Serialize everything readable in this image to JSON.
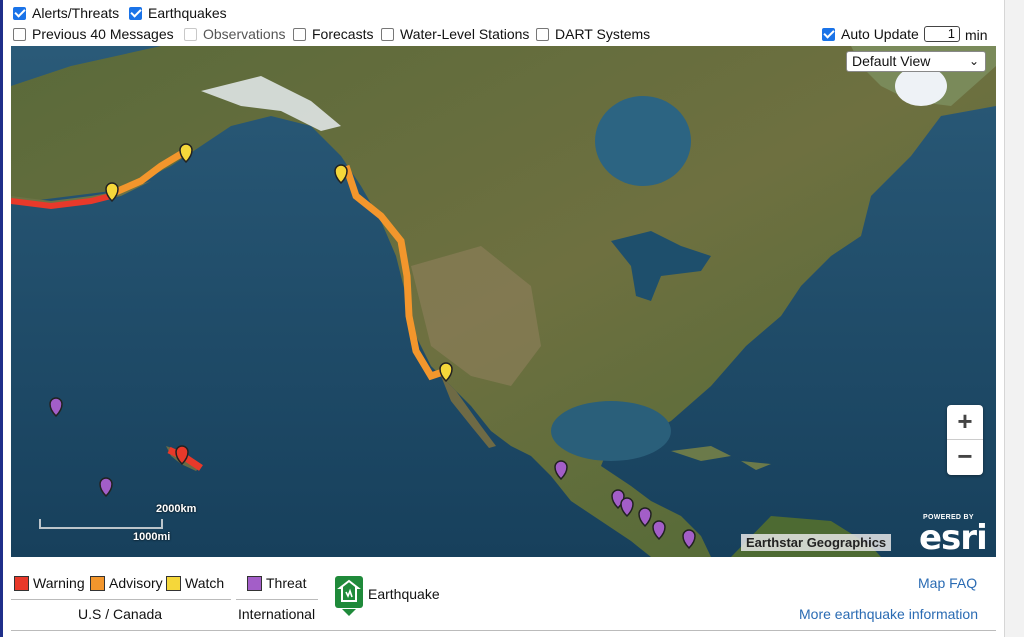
{
  "controls": {
    "row1": [
      {
        "label": "Alerts/Threats",
        "checked": true
      },
      {
        "label": "Earthquakes",
        "checked": true
      }
    ],
    "row2": [
      {
        "label": "Previous 40 Messages",
        "checked": false,
        "disabled": false
      },
      {
        "label": "Observations",
        "checked": false,
        "disabled": true
      },
      {
        "label": "Forecasts",
        "checked": false,
        "disabled": false
      },
      {
        "label": "Water-Level Stations",
        "checked": false,
        "disabled": false
      },
      {
        "label": "DART Systems",
        "checked": false,
        "disabled": false
      }
    ],
    "auto_update": {
      "label": "Auto Update",
      "checked": true,
      "interval": "1",
      "unit": "min"
    }
  },
  "map": {
    "view_select": "Default View",
    "zoom_in": "+",
    "zoom_out": "−",
    "scale_km": "2000km",
    "scale_mi": "1000mi",
    "attribution": "Earthstar Geographics",
    "powered_by": "POWERED BY",
    "logo": "esri",
    "colors": {
      "warning": "#e8392a",
      "advisory": "#f3962c",
      "watch": "#f5d73a",
      "threat": "#a35ec8",
      "ocean": "#1d4a66",
      "land": "#5c6b3c"
    }
  },
  "legend": {
    "us_canada": {
      "label": "U.S / Canada",
      "items": [
        {
          "label": "Warning",
          "color": "#e8392a"
        },
        {
          "label": "Advisory",
          "color": "#f3962c"
        },
        {
          "label": "Watch",
          "color": "#f5d73a"
        }
      ]
    },
    "international": {
      "label": "International",
      "items": [
        {
          "label": "Threat",
          "color": "#a35ec8"
        }
      ]
    },
    "earthquake": {
      "label": "Earthquake",
      "icon": "earthquake-icon"
    }
  },
  "links": {
    "map_faq": "Map FAQ",
    "more_eq": "More earthquake information"
  }
}
